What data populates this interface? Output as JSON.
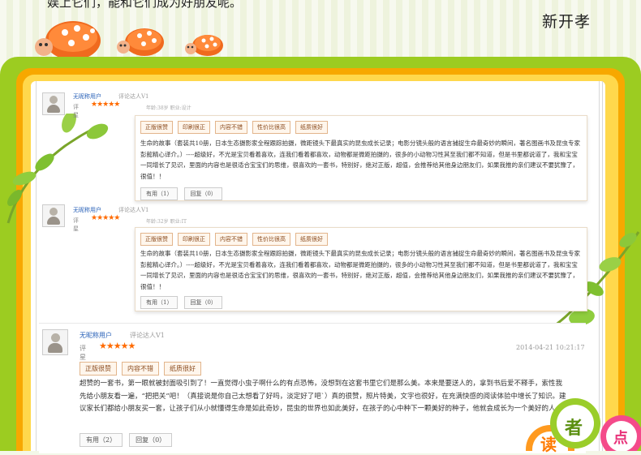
{
  "header": {
    "top_text": "娱上它们，能和它们成为好朋友呢。",
    "author": "新开孝"
  },
  "reviews": [
    {
      "user": "无昵称用户",
      "level": "评论达人V1",
      "rate_label": "评星",
      "stars": "★★★★★",
      "meta": "年龄:38岁  职业:设计",
      "tags": [
        "正版很赞",
        "印刷很正",
        "内容不错",
        "性价比很高",
        "纸质很好"
      ],
      "content": "生命的故事（套装共10册，日本生态摄影家全程跟踪拍摄，微距镜头下最真实的昆虫成长记录；电影分镜头般的语言捕捉生命最奇妙的瞬间，著名图画书及昆虫专家彭懿精心译介。）----超级好，不光是宝贝看着喜欢，连我们看着都喜欢，动物都是微距拍摄的，很多的小动物习性其至我们都不知道，但是书里都说道了，我和宝宝一同增长了见识，里面的内容也是很适合宝宝们的思维，很喜欢的一套书，特别好，绝对正版，超值，会推荐给其他身边朋友们，如果我推的亲们建议不要犹豫了，很值！！",
      "buttons": [
        "有用（1）",
        "回复（0）"
      ]
    },
    {
      "user": "无昵称用户",
      "level": "评论达人V1",
      "rate_label": "评星",
      "stars": "★★★★★",
      "meta": "年龄:32岁  职业:IT",
      "tags": [
        "正版很赞",
        "印刷很正",
        "内容不错",
        "性价比很高",
        "纸质很好"
      ],
      "content": "生命的故事（套装共10册，日本生态摄影家全程跟踪拍摄，微距镜头下最真实的昆虫成长记录；电影分镜头般的语言捕捉生命最奇妙的瞬间，著名图画书及昆虫专家彭懿精心译介。）----超级好，不光是宝贝看着喜欢，连我们看着都喜欢，动物都是微距拍摄的，很多的小动物习性其至我们都不知道，但是书里都说道了，我和宝宝一同增长了见识，里面的内容也是很适合宝宝们的思维，很喜欢的一套书，特别好，绝对正版，超值，会推荐给其他身边朋友们，如果我推的亲们建议不要犹豫了，很值！！",
      "buttons": [
        "有用（1）",
        "回复（0）"
      ]
    },
    {
      "user": "无昵称用户",
      "level": "评论达人V1",
      "rate_label": "评星",
      "stars": "★★★★★",
      "timestamp": "2014-04-21  10:21:17",
      "tags": [
        "正版很赞",
        "内容不错",
        "纸质很好"
      ],
      "content": "超赞的一套书，第一眼就被封面吸引到了！一直觉得小虫子啊什么的有点恐怖，没想到在这套书里它们是那么美。本来是要送人的，拿到书后爱不释手，索性我先给小朋友看一遍，“把把关”吧！（真接说是你自己太想看了好吗，淡定好了吧`）真的很赞，照片特美，文字也很好，在充满快感的阅读体验中增长了知识。建议家长们都给小朋友买一套，让孩子们从小就懂得生命是如此奇妙，昆虫的世界也如此美好，在孩子的心中种下一颗美好的种子，他就会成长为一个美好的人。",
      "buttons": [
        "有用（2）",
        "回复（0）"
      ]
    }
  ],
  "badges": [
    "读",
    "者",
    "点"
  ],
  "colors": {
    "frame_green": "#9ccc21",
    "frame_orange": "#f7a800",
    "frame_yellow": "#ffd84c",
    "star_orange": "#ff6a00",
    "tag_border": "#e2b58c",
    "username_blue": "#2a62b8"
  }
}
